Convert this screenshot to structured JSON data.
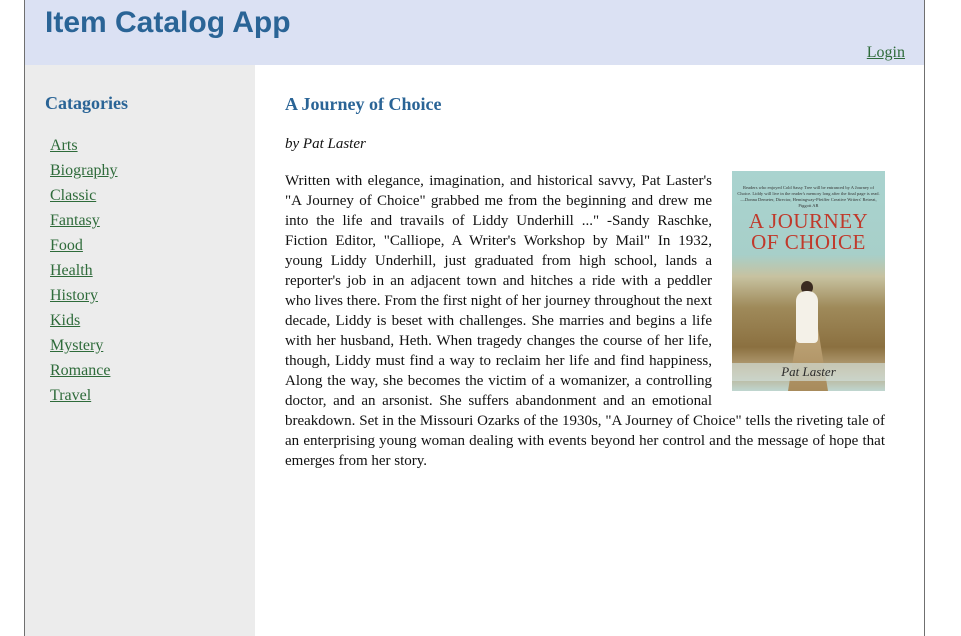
{
  "header": {
    "app_title": "Item Catalog App",
    "login_label": "Login"
  },
  "sidebar": {
    "title": "Catagories",
    "categories": [
      "Arts",
      "Biography",
      "Classic",
      "Fantasy",
      "Food",
      "Health",
      "History",
      "Kids",
      "Mystery",
      "Romance",
      "Travel"
    ]
  },
  "item": {
    "title": "A Journey of Choice",
    "author_line": "by Pat Laster",
    "description": "Written with elegance, imagination, and historical savvy, Pat Laster's \"A Journey of Choice\" grabbed me from the beginning and drew me into the life and travails of Liddy Underhill ...\" -Sandy Raschke, Fiction Editor, \"Calliope, A Writer's Workshop by Mail\" In 1932, young Liddy Underhill, just graduated from high school, lands a reporter's job in an adjacent town and hitches a ride with a peddler who lives there. From the first night of her journey throughout the next decade, Liddy is beset with challenges. She marries and begins a life with her husband, Heth. When tragedy changes the course of her life, though, Liddy must find a way to reclaim her life and find happiness, Along the way, she becomes the victim of a womanizer, a controlling doctor, and an arsonist. She suffers abandonment and an emotional breakdown. Set in the Missouri Ozarks of the 1930s, \"A Journey of Choice\" tells the riveting tale of an enterprising young woman dealing with events beyond her control and the message of hope that emerges from her story.",
    "cover": {
      "blurb": "Readers who enjoyed Cold Sassy Tree will be entranced by A Journey of Choice. Liddy will live in the reader's memory long after the final page is read. —Donna Demeter, Director, Hemingway-Pfeiffer Creative Writers' Retreat, Piggott AR",
      "title_line1": "A JOURNEY",
      "title_line2": "OF CHOICE",
      "author": "Pat Laster"
    }
  },
  "colors": {
    "header_bg": "#dbe1f3",
    "sidebar_bg": "#ececec",
    "title_blue": "#2a6496",
    "link_green": "#2e6b3a",
    "cover_title_red": "#c0392b"
  }
}
